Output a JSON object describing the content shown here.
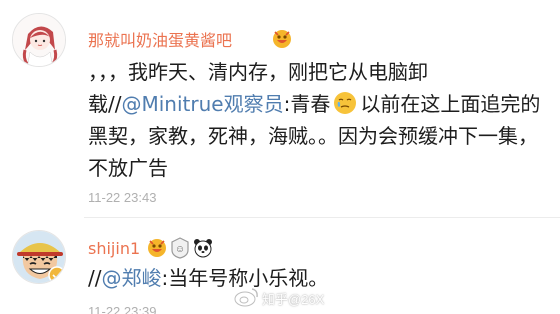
{
  "comments": [
    {
      "username": "那就叫奶油蛋黄酱吧",
      "badge": "vip-fan-icon",
      "text_before_mention": "，，，我昨天、清内存，刚把它从电脑卸载//",
      "mention": "@Minitrue观察员",
      "text_after_mention": ":青春",
      "emoji": "tearful-face-icon",
      "text_after_emoji": "以前在这上面追完的黑契，家教，死神，海贼。。因为会预缓冲下一集，不放广告",
      "time": "11-22 23:43"
    },
    {
      "username": "shijin1",
      "badges": [
        "vip-fan-icon",
        "level-badge-icon",
        "panda-icon"
      ],
      "text_before_mention": "//",
      "mention": "@郑峻",
      "text_after_mention": ":当年号称小乐视。",
      "time": "11-22 23:39"
    }
  ],
  "watermark": {
    "text": "知乎@26X",
    "icon": "weibo-logo-icon"
  },
  "colors": {
    "username": "#eb7350",
    "mention": "#507daf",
    "time": "#b0b0b0"
  }
}
